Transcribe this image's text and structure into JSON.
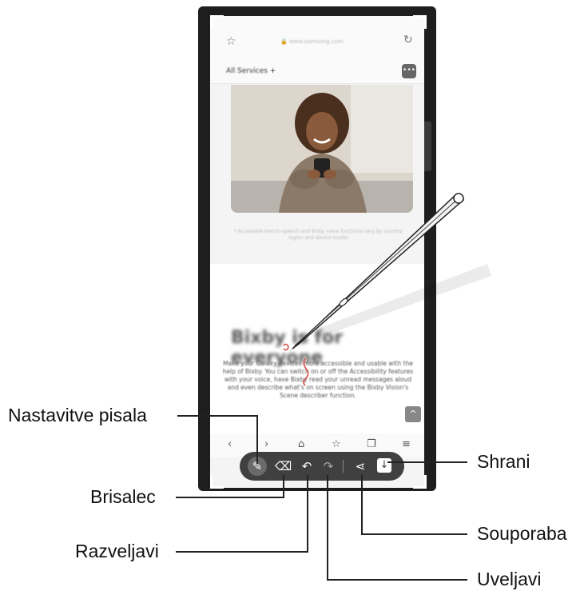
{
  "browser": {
    "url": "www.samsung.com",
    "service_label": "All Services",
    "service_plus": "+",
    "caption": "* Accessible text-to-speech and Bixby voice functions vary by country, region and device model."
  },
  "article": {
    "headline": "Bixby is for everyone",
    "paragraph": "Make your Galaxy devices more accessible and usable with the help of Bixby. You can switch on or off the Accessibility features with your voice, have Bixby read your unread messages aloud and even describe what's on screen using the Bixby Vision's Scene describer function."
  },
  "callouts": {
    "pen_settings": "Nastavitve pisala",
    "eraser": "Brisalec",
    "undo": "Razveljavi",
    "redo": "Uveljavi",
    "share": "Souporaba",
    "save": "Shrani"
  },
  "icons": {
    "favorite": "star-icon",
    "reload": "reload-icon",
    "chat": "chat-icon",
    "scroll_up": "chevron-up-icon",
    "back": "back-icon",
    "forward": "forward-icon",
    "home": "home-icon",
    "bookmarks": "bookmark-icon",
    "tabs": "tabs-icon",
    "menu": "menu-icon",
    "pen": "pen-icon",
    "eraser": "eraser-icon",
    "undo": "undo-icon",
    "redo": "redo-icon",
    "share": "share-icon",
    "save": "download-icon"
  },
  "colors": {
    "toolbar_bg": "#404040",
    "phone_frame": "#1e1e1e",
    "pen_stroke": "#d9534f"
  }
}
